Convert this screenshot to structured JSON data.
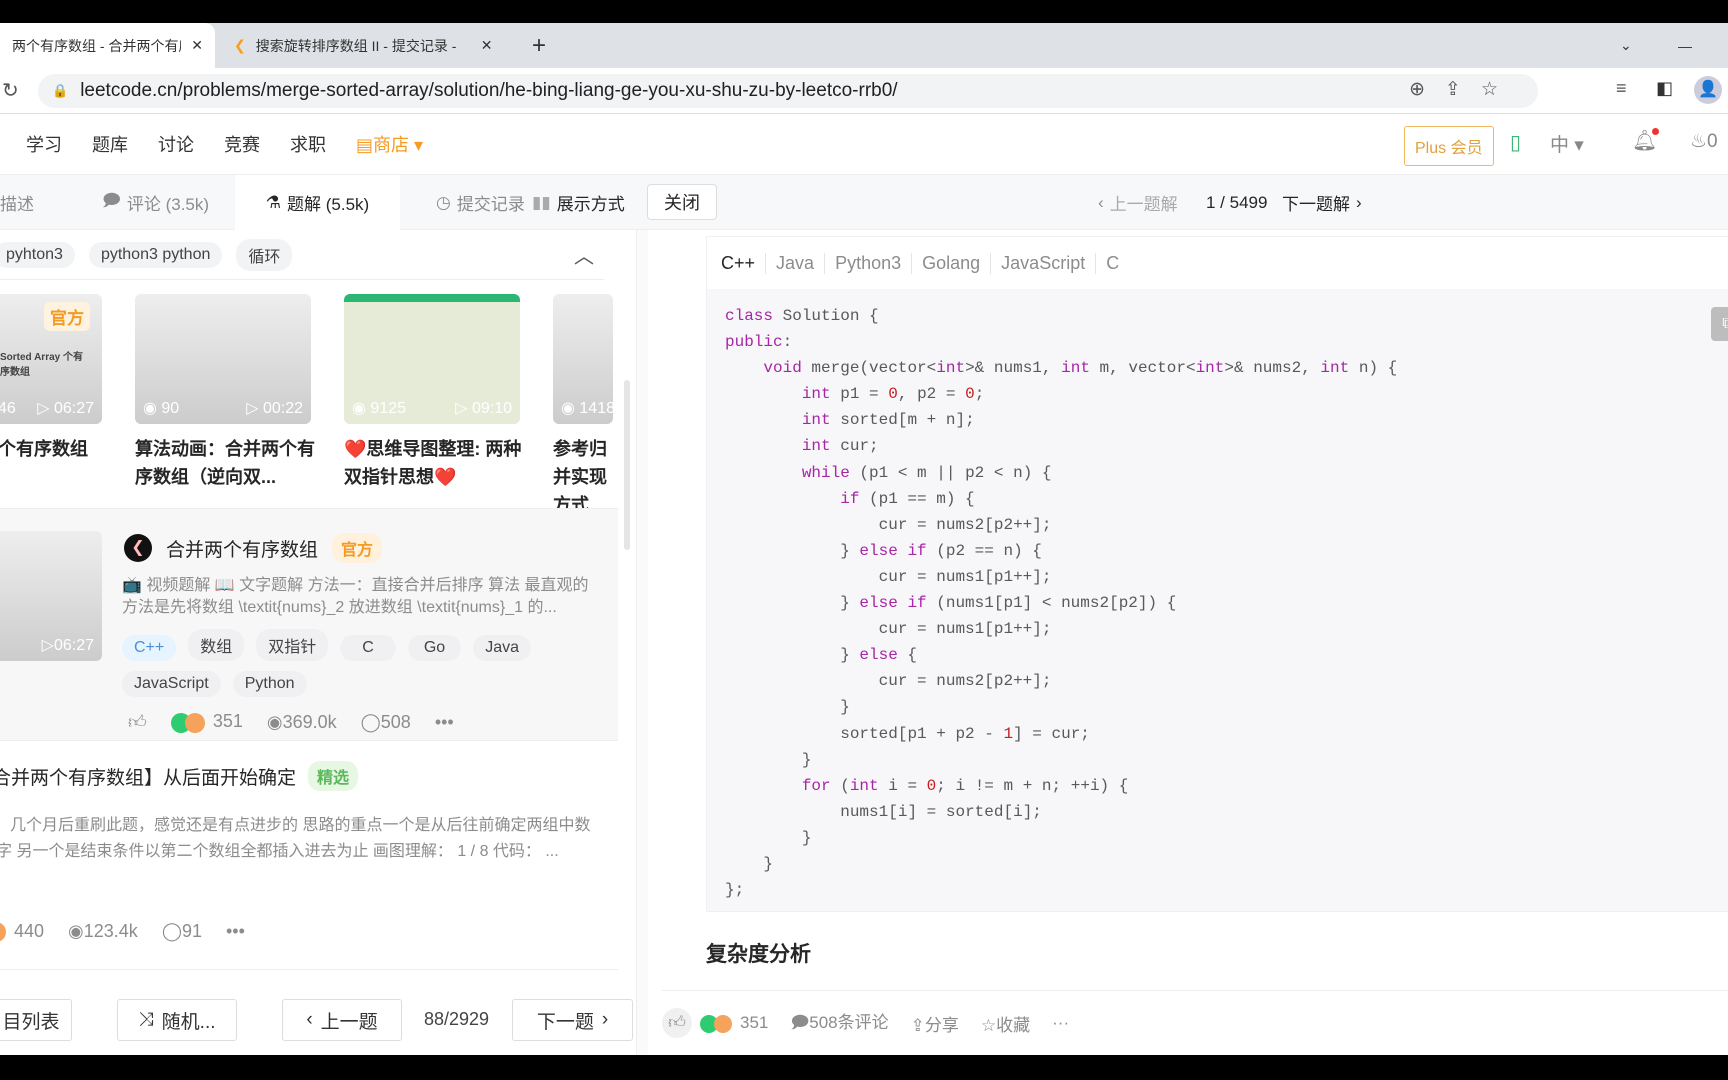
{
  "browser": {
    "tabs": [
      {
        "title": "两个有序数组 - 合并两个有序",
        "active": true
      },
      {
        "title": "搜索旋转排序数组 II - 提交记录 -",
        "active": false
      }
    ],
    "new_tab": "+",
    "url": "leetcode.cn/problems/merge-sorted-array/solution/he-bing-liang-ge-you-xu-shu-zu-by-leetco-rrb0/"
  },
  "nav": {
    "items": [
      "学习",
      "题库",
      "讨论",
      "竞赛",
      "求职"
    ],
    "store": "商店",
    "plus": "Plus 会员",
    "lang": "中",
    "points": "0"
  },
  "panel_tabs": {
    "items": [
      "描述",
      "评论 (3.5k)",
      "题解 (5.5k)",
      "提交记录"
    ],
    "display_mode": "展示方式",
    "close": "关闭",
    "prev_solution": "上一题解",
    "page": "1 / 5499",
    "next_solution": "下一题解"
  },
  "filter_chips": [
    "pyhton3",
    "python3 python",
    "循环"
  ],
  "videos": [
    {
      "badge": "官方",
      "caption": "Sorted Array 个有序数组",
      "views": "46",
      "duration": "06:27",
      "title": "个有序数组"
    },
    {
      "views": "90",
      "duration": "00:22",
      "title": "算法动画：合并两个有序数组（逆向双..."
    },
    {
      "views": "9125",
      "duration": "09:10",
      "title": "❤️思维导图整理: 两种双指针思想❤️"
    },
    {
      "views": "1418",
      "title": "参考归并实现方式"
    }
  ],
  "solutions": [
    {
      "title": "合并两个有序数组",
      "badge": "官方",
      "thumb_duration": "06:27",
      "summary": "📺 视频题解 📖 文字题解 方法一：直接合并后排序 算法 最直观的方法是先将数组 \\textit{nums}_2 放进数组 \\textit{nums}_1 的...",
      "tags": [
        "C++",
        "数组",
        "双指针",
        "C",
        "Go",
        "Java",
        "JavaScript",
        "Python"
      ],
      "likes": "351",
      "views": "369.0k",
      "comments": "508"
    },
    {
      "title": "合并两个有序数组】从后面开始确定",
      "badge": "精选",
      "summary": "几个月后重刷此题，感觉还是有点进步的 思路的重点一个是从后往前确定两组中数字 另一个是结束条件以第二个数组全都插入进去为止 画图理解： 1 / 8 代码： ...",
      "likes": "440",
      "views": "123.4k",
      "comments": "91"
    }
  ],
  "bottom_nav": {
    "list": "目列表",
    "random": "随机...",
    "prev": "上一题",
    "progress": "88/2929",
    "next": "下一题"
  },
  "code": {
    "languages": [
      "C++",
      "Java",
      "Python3",
      "Golang",
      "JavaScript",
      "C"
    ],
    "lines": [
      "class Solution {",
      "public:",
      "    void merge(vector<int>& nums1, int m, vector<int>& nums2, int n) {",
      "        int p1 = 0, p2 = 0;",
      "        int sorted[m + n];",
      "        int cur;",
      "        while (p1 < m || p2 < n) {",
      "            if (p1 == m) {",
      "                cur = nums2[p2++];",
      "            } else if (p2 == n) {",
      "                cur = nums1[p1++];",
      "            } else if (nums1[p1] < nums2[p2]) {",
      "                cur = nums1[p1++];",
      "            } else {",
      "                cur = nums2[p2++];",
      "            }",
      "            sorted[p1 + p2 - 1] = cur;",
      "        }",
      "        for (int i = 0; i != m + n; ++i) {",
      "            nums1[i] = sorted[i];",
      "        }",
      "    }",
      "};"
    ]
  },
  "complexity_heading": "复杂度分析",
  "footer": {
    "likes": "351",
    "comments": "508条评论",
    "share": "分享",
    "favorite": "收藏"
  },
  "colors": {
    "keyword": "#a626a4",
    "official_badge": "#f59a23",
    "featured_badge": "#5cb85c",
    "cpp_tag": "#e6f4ff"
  }
}
